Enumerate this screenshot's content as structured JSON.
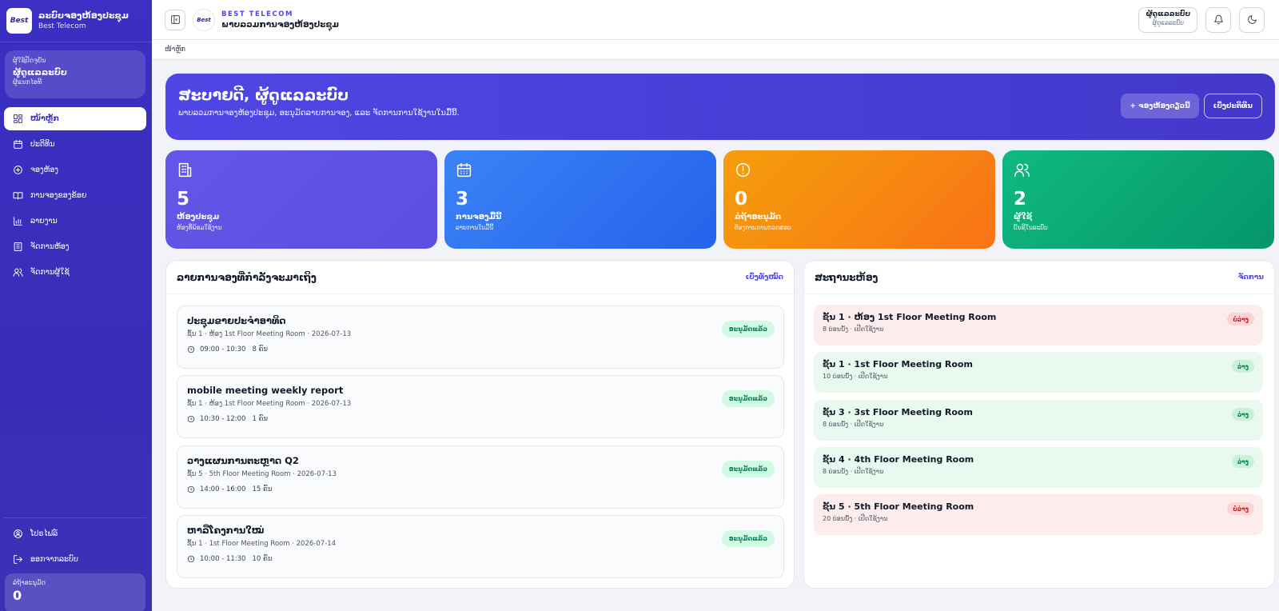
{
  "sidebar": {
    "brand_title": "ລະບົບຈອງຫ້ອງປະຊຸມ",
    "brand_sub": "Best Telecom",
    "logo_text": "Best",
    "user_card": {
      "label": "ຜູ້ໃຊ້ປັດຈຸບັນ",
      "name": "ຜູ້ດູແລລະບົບ",
      "role": "ຜູ້ແນກໄອທີ"
    },
    "items": [
      {
        "label": "ໜ້າຫຼັກ",
        "icon": "dashboard-icon",
        "active": true
      },
      {
        "label": "ປະຕິທິນ",
        "icon": "calendar-icon"
      },
      {
        "label": "ຈອງຫ້ອງ",
        "icon": "plus-circle-icon"
      },
      {
        "label": "ການຈອງຂອງຂ້ອຍ",
        "icon": "book-icon"
      },
      {
        "label": "ລາຍງານ",
        "icon": "bar-chart-icon"
      },
      {
        "label": "ຈັດການຫ້ອງ",
        "icon": "building-icon"
      },
      {
        "label": "ຈັດການຜູ້ໃຊ້",
        "icon": "users-icon"
      }
    ],
    "bottom_items": [
      {
        "label": "ໂປຣໄຟລ໌",
        "icon": "user-circle-icon"
      },
      {
        "label": "ອອກຈາກລະບົບ",
        "icon": "logout-icon"
      }
    ],
    "pending": {
      "label": "ລໍຖ້າອະນຸມັດ",
      "value": "0"
    }
  },
  "topbar": {
    "kicker": "BEST TELECOM",
    "title": "ພາບລວມການຈອງຫ້ອງປະຊຸມ",
    "user_name": "ຜູ້ດູແລລະບົບ",
    "user_role": "ຜູ້ດູແລລະບົບ"
  },
  "breadcrumb": "ໜ້າຫຼັກ",
  "hero": {
    "title": "ສະບາຍດີ, ຜູ້ດູແລລະບົບ",
    "subtitle": "ພາບລວມການຈອງຫ້ອງປະຊຸມ, ອະນຸມັດລາຍການຈອງ, ແລະ ຈັດການການໃຊ້ງານໃນມື້ນີ້.",
    "primary_button": "+ ຈອງຫ້ອງດຽວນີ້",
    "secondary_button": "ເບິ່ງປະຕິທິນ"
  },
  "stats": [
    {
      "value": "5",
      "title": "ຫ້ອງປະຊຸມ",
      "sub": "ຫ້ອງທີ່ພ້ອມໃຊ້ງານ",
      "icon": "building-icon",
      "gradient": [
        "#6457e8",
        "#5b4fe0"
      ]
    },
    {
      "value": "3",
      "title": "ການຈອງມື້ນີ້",
      "sub": "ລາຍການໃນມື້ນີ້",
      "icon": "calendar-icon",
      "gradient": [
        "#3b82f6",
        "#2563eb"
      ]
    },
    {
      "value": "0",
      "title": "ລໍຖ້າອະນຸມັດ",
      "sub": "ຕ້ອງການການກວດສອບ",
      "icon": "alert-circle-icon",
      "gradient": [
        "#f59e0b",
        "#f97316"
      ]
    },
    {
      "value": "2",
      "title": "ຜູ້ໃຊ້",
      "sub": "ບັນຊີໃນລະບົບ",
      "icon": "users-icon",
      "gradient": [
        "#10b981",
        "#059669"
      ]
    }
  ],
  "upcoming": {
    "title": "ລາຍການຈອງທີ່ກຳລັງຈະມາເຖິງ",
    "link": "ເບິ່ງທັງໝົດ",
    "items": [
      {
        "title": "ປະຊຸມຂາຍປະຈຳອາທິດ",
        "sub": "ຊັ້ນ 1 · ຫ້ອງ 1st Floor Meeting Room · 2026-07-13",
        "time": "09:00 - 10:30",
        "attendees": "8 ຄົນ",
        "status": "ອະນຸມັດແລ້ວ"
      },
      {
        "title": "mobile meeting weekly report",
        "sub": "ຊັ້ນ 1 · ຫ້ອງ 1st Floor Meeting Room · 2026-07-13",
        "time": "10:30 - 12:00",
        "attendees": "1 ຄົນ",
        "status": "ອະນຸມັດແລ້ວ"
      },
      {
        "title": "ວາງແຜນການຕະຫຼາດ Q2",
        "sub": "ຊັ້ນ 5 · 5th Floor Meeting Room · 2026-07-13",
        "time": "14:00 - 16:00",
        "attendees": "15 ຄົນ",
        "status": "ອະນຸມັດແລ້ວ"
      },
      {
        "title": "ຫາລືໂຄງການໃໝ່",
        "sub": "ຊັ້ນ 1 · 1st Floor Meeting Room · 2026-07-14",
        "time": "10:00 - 11:30",
        "attendees": "10 ຄົນ",
        "status": "ອະນຸມັດແລ້ວ"
      }
    ]
  },
  "rooms": {
    "title": "ສະຖານະຫ້ອງ",
    "link": "ຈັດການ",
    "items": [
      {
        "title": "ຊັ້ນ 1 · ຫ້ອງ 1st Floor Meeting Room",
        "sub": "8 ບ່ອນນັ່ງ · ເປີດໃຊ້ງານ",
        "status": "ບໍ່ວ່າງ",
        "state": "busy"
      },
      {
        "title": "ຊັ້ນ 1 · 1st Floor Meeting Room",
        "sub": "10 ບ່ອນນັ່ງ · ເປີດໃຊ້ງານ",
        "status": "ວ່າງ",
        "state": "free"
      },
      {
        "title": "ຊັ້ນ 3 · 3st Floor Meeting Room",
        "sub": "8 ບ່ອນນັ່ງ · ເປີດໃຊ້ງານ",
        "status": "ວ່າງ",
        "state": "free"
      },
      {
        "title": "ຊັ້ນ 4 · 4th Floor Meeting Room",
        "sub": "8 ບ່ອນນັ່ງ · ເປີດໃຊ້ງານ",
        "status": "ວ່າງ",
        "state": "free"
      },
      {
        "title": "ຊັ້ນ 5 · 5th Floor Meeting Room",
        "sub": "20 ບ່ອນນັ່ງ · ເປີດໃຊ້ງານ",
        "status": "ບໍ່ວ່າງ",
        "state": "busy"
      }
    ]
  }
}
